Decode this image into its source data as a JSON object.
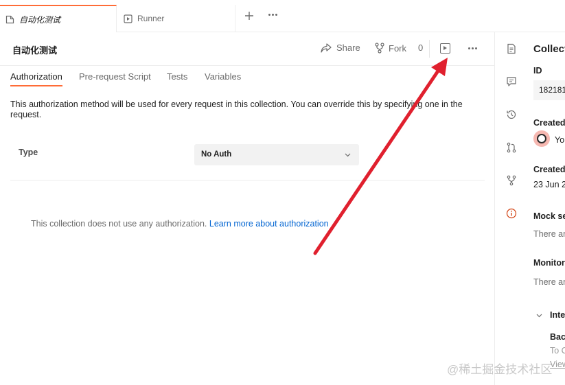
{
  "tabs": [
    {
      "label": "自动化测试",
      "icon": "collection-icon",
      "active": true
    },
    {
      "label": "Runner",
      "icon": "runner-icon",
      "active": false
    }
  ],
  "collection": {
    "title": "自动化测试",
    "share_label": "Share",
    "fork_label": "Fork",
    "fork_count": "0"
  },
  "subtabs": [
    "Authorization",
    "Pre-request Script",
    "Tests",
    "Variables"
  ],
  "authorization": {
    "description": "This authorization method will be used for every request in this collection. You can override this by specifying one in the request.",
    "type_label": "Type",
    "type_value": "No Auth",
    "no_auth_message": "This collection does not use any authorization.",
    "learn_more": "Learn more about authorization ↗"
  },
  "right_panel": {
    "title": "Collect",
    "id_label": "ID",
    "id_value": "182181",
    "created_by_label": "Created",
    "created_by_value": "Yo",
    "created_on_label": "Created",
    "created_on_value": "23 Jun 2",
    "mock_label": "Mock se",
    "mock_text": "There ar",
    "monitor_label": "Monitor",
    "monitor_text": "There ar",
    "integrations_label": "Inte",
    "backup_label": "Bac",
    "backup_text": "To C",
    "view_link": "View"
  },
  "watermark": "@稀土掘金技术社区",
  "colors": {
    "accent": "#ff6c37",
    "link": "#0265d2",
    "annotation_arrow": "#e0202e"
  }
}
